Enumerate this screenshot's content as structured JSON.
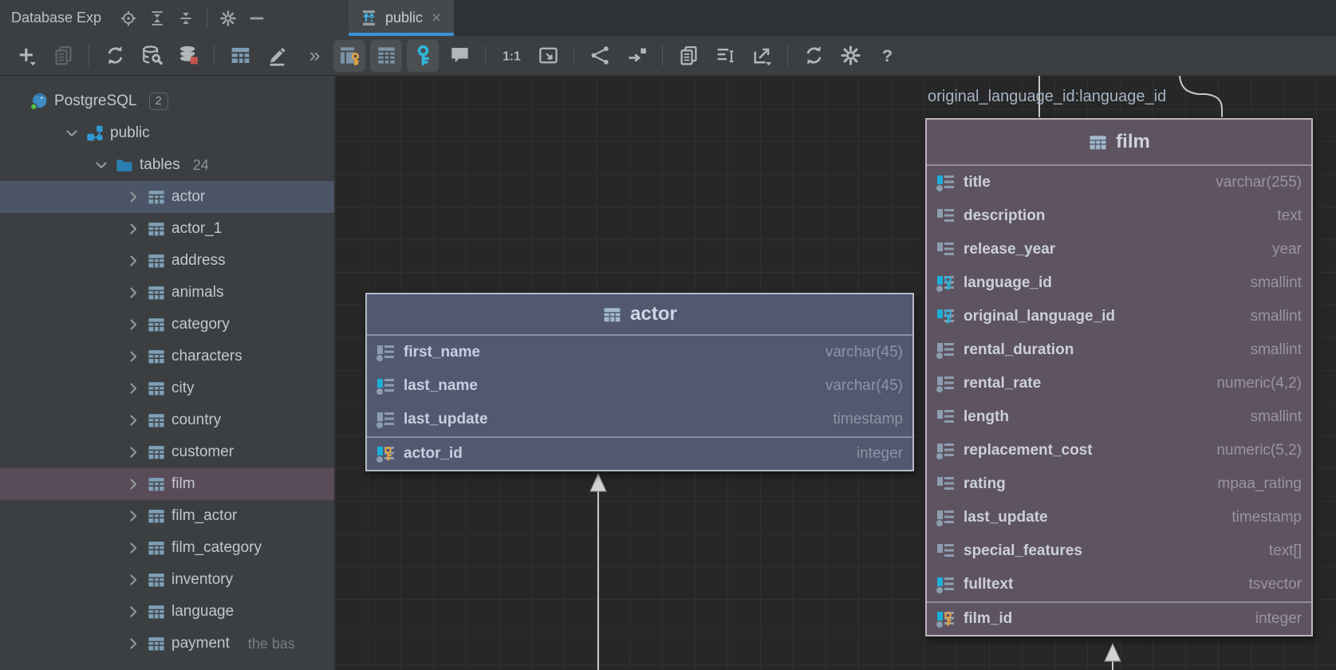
{
  "window": {
    "title": "Database Exp"
  },
  "panel_header": {
    "buttons_a": [
      {
        "dname": "locate-button",
        "icon": "target"
      },
      {
        "dname": "expand-all-button",
        "icon": "expand"
      },
      {
        "dname": "collapse-all-button",
        "icon": "collapse"
      }
    ],
    "buttons_b": [
      {
        "dname": "panel-options-button",
        "icon": "gear"
      },
      {
        "dname": "hide-panel-button",
        "icon": "minus"
      }
    ]
  },
  "tabbar": {
    "tabs": [
      {
        "label": "public"
      }
    ]
  },
  "toolbar": {
    "overflow_label": "»",
    "left_groups": {
      "g1": [
        {
          "dname": "new-item-button",
          "icon": "plus"
        },
        {
          "dname": "duplicate-button",
          "icon": "copy",
          "classes": "disabled"
        }
      ],
      "g2": [
        {
          "dname": "refresh-button",
          "icon": "refresh"
        },
        {
          "dname": "data-source-properties-button",
          "icon": "dbwrench"
        },
        {
          "dname": "disconnect-button",
          "icon": "dboff"
        }
      ],
      "g3": [
        {
          "dname": "open-table-button",
          "icon": "table"
        },
        {
          "dname": "edit-button",
          "icon": "pencil"
        }
      ]
    },
    "diagram_groups": {
      "g4": [
        {
          "dname": "show-key-columns-toggle",
          "icon": "tablekey",
          "classes": "on"
        },
        {
          "dname": "show-all-columns-toggle",
          "icon": "tablecols",
          "classes": "on"
        },
        {
          "dname": "show-keys-toggle",
          "icon": "bigkey",
          "classes": "on"
        },
        {
          "dname": "show-comments-toggle",
          "icon": "comment"
        }
      ],
      "g5": [
        {
          "dname": "actual-size-button",
          "icon": "one2one"
        },
        {
          "dname": "fit-content-button",
          "icon": "fit"
        }
      ],
      "g6": [
        {
          "dname": "merge-nodes-button",
          "icon": "branch"
        },
        {
          "dname": "jump-to-source-button",
          "icon": "jump"
        }
      ],
      "g7": [
        {
          "dname": "copy-diagram-button",
          "icon": "copy"
        },
        {
          "dname": "edit-selection-button",
          "icon": "list"
        },
        {
          "dname": "export-diagram-button",
          "icon": "export"
        }
      ],
      "g8": [
        {
          "dname": "refresh-diagram-button",
          "icon": "refresh"
        },
        {
          "dname": "diagram-settings-button",
          "icon": "gear"
        },
        {
          "dname": "help-button",
          "icon": "help"
        }
      ]
    }
  },
  "tree": {
    "items": [
      {
        "dname": "tree-item-postgresql",
        "classes": "lvl0",
        "chev": "none",
        "icon": "pg",
        "label": "PostgreSQL",
        "badge": "2",
        "count": "",
        "comment": ""
      },
      {
        "dname": "tree-item-public",
        "classes": "lvl1",
        "chev": "down",
        "icon": "schema",
        "label": "public",
        "badge": "",
        "count": "",
        "comment": ""
      },
      {
        "dname": "tree-item-tables",
        "classes": "lvl2",
        "chev": "down",
        "icon": "folder",
        "label": "tables",
        "badge": "",
        "count": "24",
        "comment": ""
      },
      {
        "dname": "tree-item-actor",
        "classes": "lvl3 sel-blue",
        "chev": "right",
        "icon": "ttable",
        "label": "actor",
        "badge": "",
        "count": "",
        "comment": ""
      },
      {
        "dname": "tree-item-actor-1",
        "classes": "lvl3",
        "chev": "right",
        "icon": "ttable",
        "label": "actor_1",
        "badge": "",
        "count": "",
        "comment": ""
      },
      {
        "dname": "tree-item-address",
        "classes": "lvl3",
        "chev": "right",
        "icon": "ttable",
        "label": "address",
        "badge": "",
        "count": "",
        "comment": ""
      },
      {
        "dname": "tree-item-animals",
        "classes": "lvl3",
        "chev": "right",
        "icon": "ttable",
        "label": "animals",
        "badge": "",
        "count": "",
        "comment": ""
      },
      {
        "dname": "tree-item-category",
        "classes": "lvl3",
        "chev": "right",
        "icon": "ttable",
        "label": "category",
        "badge": "",
        "count": "",
        "comment": ""
      },
      {
        "dname": "tree-item-characters",
        "classes": "lvl3",
        "chev": "right",
        "icon": "ttable",
        "label": "characters",
        "badge": "",
        "count": "",
        "comment": ""
      },
      {
        "dname": "tree-item-city",
        "classes": "lvl3",
        "chev": "right",
        "icon": "ttable",
        "label": "city",
        "badge": "",
        "count": "",
        "comment": ""
      },
      {
        "dname": "tree-item-country",
        "classes": "lvl3",
        "chev": "right",
        "icon": "ttable",
        "label": "country",
        "badge": "",
        "count": "",
        "comment": ""
      },
      {
        "dname": "tree-item-customer",
        "classes": "lvl3",
        "chev": "right",
        "icon": "ttable",
        "label": "customer",
        "badge": "",
        "count": "",
        "comment": ""
      },
      {
        "dname": "tree-item-film",
        "classes": "lvl3 sel-mauve",
        "chev": "right",
        "icon": "ttable",
        "label": "film",
        "badge": "",
        "count": "",
        "comment": ""
      },
      {
        "dname": "tree-item-film-actor",
        "classes": "lvl3",
        "chev": "right",
        "icon": "ttable",
        "label": "film_actor",
        "badge": "",
        "count": "",
        "comment": ""
      },
      {
        "dname": "tree-item-film-category",
        "classes": "lvl3",
        "chev": "right",
        "icon": "ttable",
        "label": "film_category",
        "badge": "",
        "count": "",
        "comment": ""
      },
      {
        "dname": "tree-item-inventory",
        "classes": "lvl3",
        "chev": "right",
        "icon": "ttable",
        "label": "inventory",
        "badge": "",
        "count": "",
        "comment": ""
      },
      {
        "dname": "tree-item-language",
        "classes": "lvl3",
        "chev": "right",
        "icon": "ttable",
        "label": "language",
        "badge": "",
        "count": "",
        "comment": ""
      },
      {
        "dname": "tree-item-payment",
        "classes": "lvl3",
        "chev": "right",
        "icon": "ttable",
        "label": "payment",
        "badge": "",
        "count": "",
        "comment": "the bas"
      }
    ]
  },
  "diagram": {
    "edge_label": "original_language_id:language_id",
    "nodes": {
      "actor": {
        "title": "actor",
        "fields": [
          {
            "dname": "field-row-first-name",
            "name": "first_name",
            "type": "varchar(45)",
            "ic": "dot"
          },
          {
            "dname": "field-row-last-name",
            "name": "last_name",
            "type": "varchar(45)",
            "ic": "bar-cyan dot"
          },
          {
            "dname": "field-row-last-update",
            "name": "last_update",
            "type": "timestamp",
            "ic": "dot"
          },
          {
            "dname": "field-row-actor-id",
            "name": "actor_id",
            "type": "integer",
            "ic": "bar-cyan key-gold dot",
            "classes": "pk"
          }
        ]
      },
      "film": {
        "title": "film",
        "fields": [
          {
            "dname": "field-row-title",
            "name": "title",
            "type": "varchar(255)",
            "ic": "bar-cyan dot"
          },
          {
            "dname": "field-row-description",
            "name": "description",
            "type": "text",
            "ic": ""
          },
          {
            "dname": "field-row-release-year",
            "name": "release_year",
            "type": "year",
            "ic": ""
          },
          {
            "dname": "field-row-language-id",
            "name": "language_id",
            "type": "smallint",
            "ic": "bar-cyan key-cyan dot"
          },
          {
            "dname": "field-row-original-language-id",
            "name": "original_language_id",
            "type": "smallint",
            "ic": "bar-cyan key-cyan"
          },
          {
            "dname": "field-row-rental-duration",
            "name": "rental_duration",
            "type": "smallint",
            "ic": "dot"
          },
          {
            "dname": "field-row-rental-rate",
            "name": "rental_rate",
            "type": "numeric(4,2)",
            "ic": "dot"
          },
          {
            "dname": "field-row-length",
            "name": "length",
            "type": "smallint",
            "ic": ""
          },
          {
            "dname": "field-row-replacement-cost",
            "name": "replacement_cost",
            "type": "numeric(5,2)",
            "ic": "dot"
          },
          {
            "dname": "field-row-rating",
            "name": "rating",
            "type": "mpaa_rating",
            "ic": ""
          },
          {
            "dname": "field-row-last-update",
            "name": "last_update",
            "type": "timestamp",
            "ic": "dot"
          },
          {
            "dname": "field-row-special-features",
            "name": "special_features",
            "type": "text[]",
            "ic": ""
          },
          {
            "dname": "field-row-fulltext",
            "name": "fulltext",
            "type": "tsvector",
            "ic": "bar-cyan dot"
          },
          {
            "dname": "field-row-film-id",
            "name": "film_id",
            "type": "integer",
            "ic": "bar-cyan key-gold dot",
            "classes": "pk"
          }
        ]
      }
    }
  }
}
